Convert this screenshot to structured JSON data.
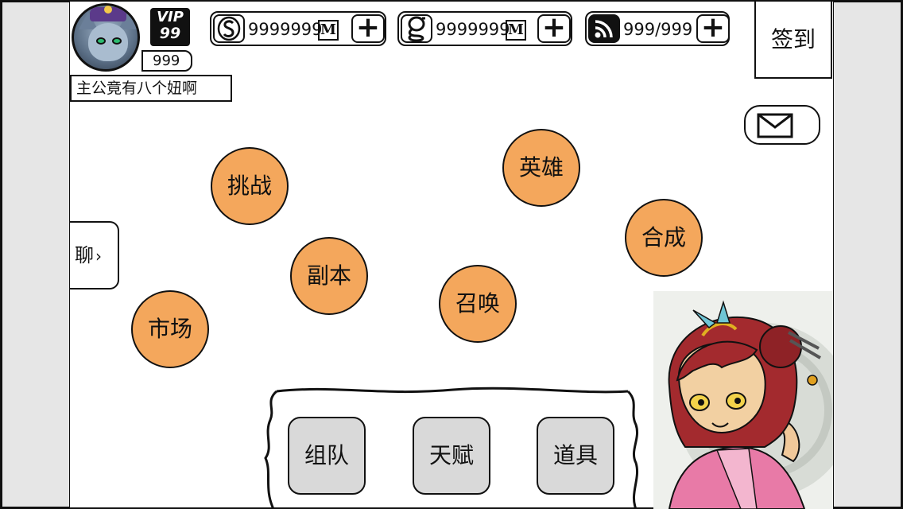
{
  "player": {
    "vip_label": "VIP",
    "vip_level": "99",
    "level": "999",
    "nickname": "主公竟有八个妞啊"
  },
  "resources": [
    {
      "icon": "S",
      "icon_name": "silver-coin-icon",
      "value": "9999999",
      "mark": "M"
    },
    {
      "icon": "g",
      "icon_name": "gold-coin-icon",
      "value": "9999999",
      "mark": "M"
    },
    {
      "icon": "rss",
      "icon_name": "stamina-icon",
      "value": "999/999"
    }
  ],
  "plus_label": "+",
  "signin_label": "签到",
  "chat_label": "聊",
  "chat_arrow": "›",
  "menu": {
    "challenge": "挑战",
    "heroes": "英雄",
    "synthesis": "合成",
    "dungeon": "副本",
    "summon": "召唤",
    "market": "市场"
  },
  "bottom_buttons": {
    "team": "组队",
    "talent": "天赋",
    "items": "道具"
  },
  "colors": {
    "orb": "#f4a75c",
    "button_gray": "#d9d9d9",
    "gutter": "#e6e6e6"
  }
}
